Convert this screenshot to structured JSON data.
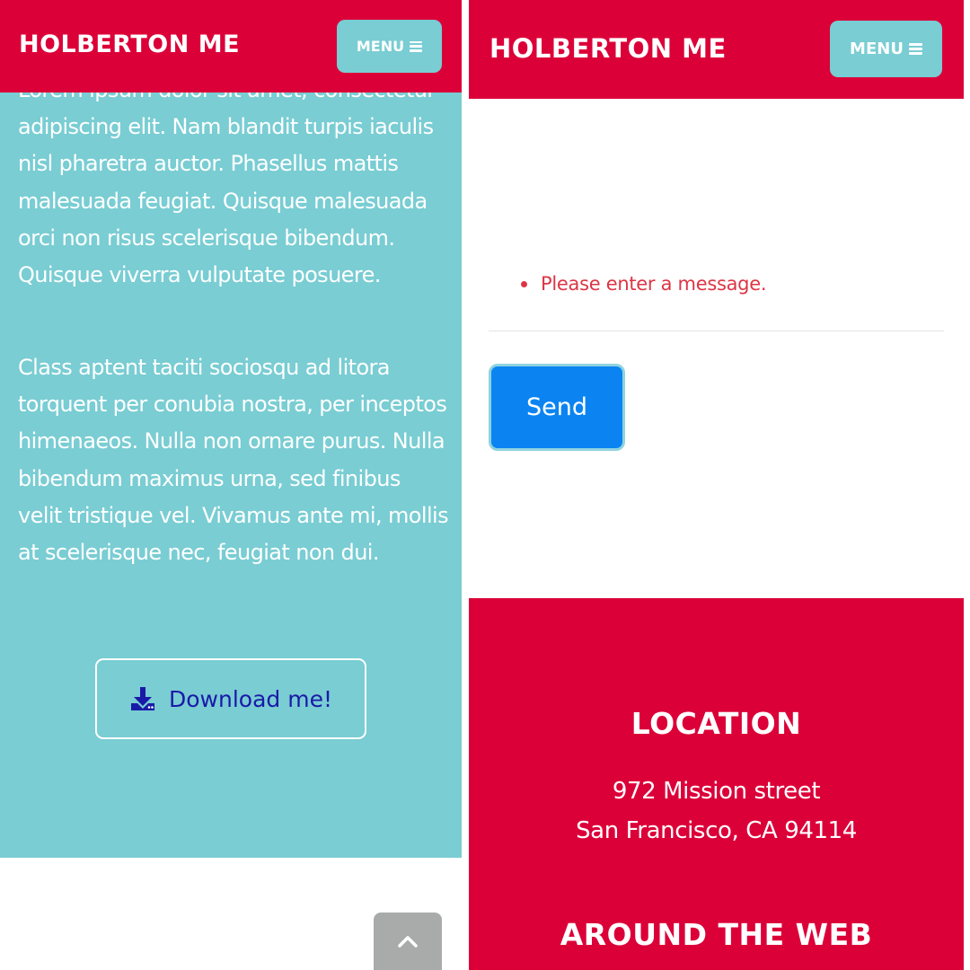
{
  "left_panel": {
    "navbar": {
      "brand": "HOLBERTON ME",
      "menu_label": "MENU",
      "menu_icon": "bars-icon"
    },
    "about": {
      "paragraph_1": "Lorem ipsum dolor sit amet, consectetur adipiscing elit. Nam blandit turpis iaculis nisl pharetra auctor. Phasellus mattis malesuada feugiat. Quisque malesuada orci non risus scelerisque bibendum. Quisque viverra vulputate posuere.",
      "paragraph_2": "Class aptent taciti sociosqu ad litora torquent per conubia nostra, per inceptos himenaeos. Nulla non ornare purus. Nulla bibendum maximus urna, sed finibus velit tristique vel. Vivamus ante mi, mollis at scelerisque nec, feugiat non dui.",
      "download_label": "Download me!",
      "download_icon": "download-icon"
    },
    "scroll_top_icon": "chevron-up-icon"
  },
  "right_panel": {
    "navbar": {
      "brand": "HOLBERTON ME",
      "menu_label": "MENU",
      "menu_icon": "bars-icon"
    },
    "contact": {
      "errors": [
        "Please enter a message."
      ],
      "send_label": "Send"
    },
    "footer": {
      "location_title": "LOCATION",
      "address_line_1": "972 Mission street",
      "address_line_2": "San Francisco, CA 94114",
      "around_web_title": "AROUND THE WEB"
    }
  },
  "colors": {
    "primary_red": "#dc0039",
    "teal": "#79cdd3",
    "send_blue": "#0b84f2",
    "error_red": "#dc3545",
    "download_text": "#1a1aa8",
    "scroll_top_gray": "#a9aaaa"
  }
}
